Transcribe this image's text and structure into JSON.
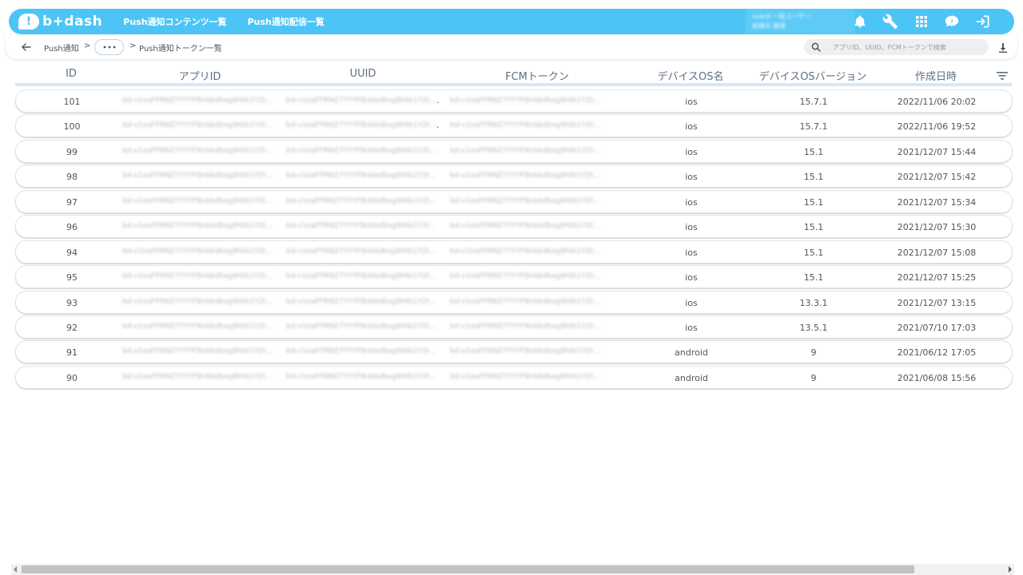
{
  "app": {
    "logo_mark": "!",
    "logo_text": "b+dash"
  },
  "topnav": {
    "links": [
      "Push通知コンテンツ一覧",
      "Push通知配信一覧"
    ],
    "user_line1": "userA 一般ユーザー",
    "user_line2": "組織名 顧客"
  },
  "breadcrumb": {
    "back_icon": "arrow-left-icon",
    "root": "Push通知",
    "sep1": ">",
    "more_icon": "more-horizontal-icon",
    "sep2": ">",
    "current": "Push通知トークン一覧"
  },
  "search": {
    "placeholder": "アプリID、UUID、FCMトークンで検索"
  },
  "columns": {
    "id": "ID",
    "app_id": "アプリID",
    "uuid": "UUID",
    "fcm": "FCMトークン",
    "os": "デバイスOS名",
    "os_version": "デバイスOSバージョン",
    "created": "作成日時"
  },
  "masked_text": "bd-v1eaFFRNZ7YYYF8nbkdbxg9Hib1Y2t...",
  "rows": [
    {
      "id": "101",
      "os": "ios",
      "ver": "15.7.1",
      "created": "2022/11/06 20:02",
      "uuid_dot": "."
    },
    {
      "id": "100",
      "os": "ios",
      "ver": "15.7.1",
      "created": "2022/11/06 19:52",
      "uuid_dot": "."
    },
    {
      "id": "99",
      "os": "ios",
      "ver": "15.1",
      "created": "2021/12/07 15:44",
      "uuid_dot": ""
    },
    {
      "id": "98",
      "os": "ios",
      "ver": "15.1",
      "created": "2021/12/07 15:42",
      "uuid_dot": ""
    },
    {
      "id": "97",
      "os": "ios",
      "ver": "15.1",
      "created": "2021/12/07 15:34",
      "uuid_dot": ""
    },
    {
      "id": "96",
      "os": "ios",
      "ver": "15.1",
      "created": "2021/12/07 15:30",
      "uuid_dot": ""
    },
    {
      "id": "94",
      "os": "ios",
      "ver": "15.1",
      "created": "2021/12/07 15:08",
      "uuid_dot": ""
    },
    {
      "id": "95",
      "os": "ios",
      "ver": "15.1",
      "created": "2021/12/07 15:25",
      "uuid_dot": ""
    },
    {
      "id": "93",
      "os": "ios",
      "ver": "13.3.1",
      "created": "2021/12/07 13:15",
      "uuid_dot": ""
    },
    {
      "id": "92",
      "os": "ios",
      "ver": "13.5.1",
      "created": "2021/07/10 17:03",
      "uuid_dot": ""
    },
    {
      "id": "91",
      "os": "android",
      "ver": "9",
      "created": "2021/06/12 17:05",
      "uuid_dot": ""
    },
    {
      "id": "90",
      "os": "android",
      "ver": "9",
      "created": "2021/06/08 15:56",
      "uuid_dot": ""
    }
  ],
  "colors": {
    "accent": "#4cc5f6",
    "header_text": "#5d6f82",
    "header_rule": "#d7e7f5"
  }
}
